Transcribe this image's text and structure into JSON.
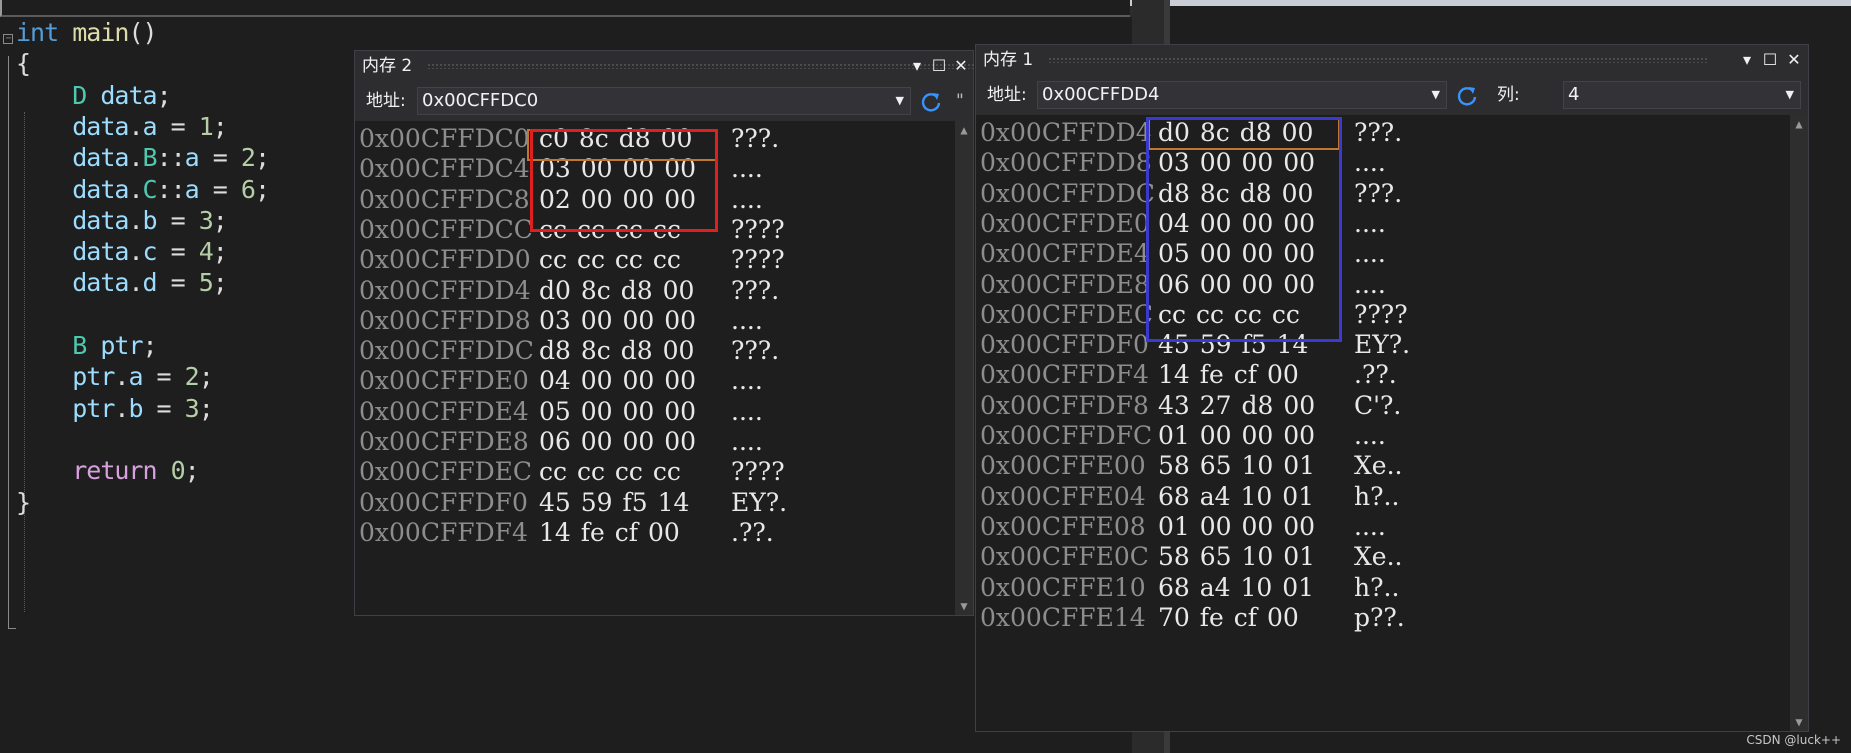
{
  "code": {
    "lines": [
      {
        "parts": [
          {
            "t": "int",
            "c": "k-blue"
          },
          {
            "t": " ",
            "c": "k-white"
          },
          {
            "t": "main",
            "c": "k-yellow"
          },
          {
            "t": "()",
            "c": "k-white"
          }
        ]
      },
      {
        "parts": [
          {
            "t": "{",
            "c": "k-white"
          }
        ]
      },
      {
        "parts": [
          {
            "t": "    ",
            "c": "k-white"
          },
          {
            "t": "D",
            "c": "k-green"
          },
          {
            "t": " ",
            "c": "k-white"
          },
          {
            "t": "data",
            "c": "k-var"
          },
          {
            "t": ";",
            "c": "k-white"
          }
        ]
      },
      {
        "parts": [
          {
            "t": "    ",
            "c": "k-white"
          },
          {
            "t": "data",
            "c": "k-var"
          },
          {
            "t": ".",
            "c": "k-white"
          },
          {
            "t": "a",
            "c": "k-var"
          },
          {
            "t": " = ",
            "c": "k-white"
          },
          {
            "t": "1",
            "c": "k-num"
          },
          {
            "t": ";",
            "c": "k-white"
          }
        ]
      },
      {
        "parts": [
          {
            "t": "    ",
            "c": "k-white"
          },
          {
            "t": "data",
            "c": "k-var"
          },
          {
            "t": ".",
            "c": "k-white"
          },
          {
            "t": "B",
            "c": "k-green"
          },
          {
            "t": "::",
            "c": "k-white"
          },
          {
            "t": "a",
            "c": "k-var"
          },
          {
            "t": " = ",
            "c": "k-white"
          },
          {
            "t": "2",
            "c": "k-num"
          },
          {
            "t": ";",
            "c": "k-white"
          }
        ]
      },
      {
        "parts": [
          {
            "t": "    ",
            "c": "k-white"
          },
          {
            "t": "data",
            "c": "k-var"
          },
          {
            "t": ".",
            "c": "k-white"
          },
          {
            "t": "C",
            "c": "k-green"
          },
          {
            "t": "::",
            "c": "k-white"
          },
          {
            "t": "a",
            "c": "k-var"
          },
          {
            "t": " = ",
            "c": "k-white"
          },
          {
            "t": "6",
            "c": "k-num"
          },
          {
            "t": ";",
            "c": "k-white"
          }
        ]
      },
      {
        "parts": [
          {
            "t": "    ",
            "c": "k-white"
          },
          {
            "t": "data",
            "c": "k-var"
          },
          {
            "t": ".",
            "c": "k-white"
          },
          {
            "t": "b",
            "c": "k-var"
          },
          {
            "t": " = ",
            "c": "k-white"
          },
          {
            "t": "3",
            "c": "k-num"
          },
          {
            "t": ";",
            "c": "k-white"
          }
        ]
      },
      {
        "parts": [
          {
            "t": "    ",
            "c": "k-white"
          },
          {
            "t": "data",
            "c": "k-var"
          },
          {
            "t": ".",
            "c": "k-white"
          },
          {
            "t": "c",
            "c": "k-var"
          },
          {
            "t": " = ",
            "c": "k-white"
          },
          {
            "t": "4",
            "c": "k-num"
          },
          {
            "t": ";",
            "c": "k-white"
          }
        ]
      },
      {
        "parts": [
          {
            "t": "    ",
            "c": "k-white"
          },
          {
            "t": "data",
            "c": "k-var"
          },
          {
            "t": ".",
            "c": "k-white"
          },
          {
            "t": "d",
            "c": "k-var"
          },
          {
            "t": " = ",
            "c": "k-white"
          },
          {
            "t": "5",
            "c": "k-num"
          },
          {
            "t": ";",
            "c": "k-white"
          }
        ]
      },
      {
        "parts": []
      },
      {
        "parts": [
          {
            "t": "    ",
            "c": "k-white"
          },
          {
            "t": "B",
            "c": "k-green"
          },
          {
            "t": " ",
            "c": "k-white"
          },
          {
            "t": "ptr",
            "c": "k-var"
          },
          {
            "t": ";",
            "c": "k-white"
          }
        ]
      },
      {
        "parts": [
          {
            "t": "    ",
            "c": "k-white"
          },
          {
            "t": "ptr",
            "c": "k-var"
          },
          {
            "t": ".",
            "c": "k-white"
          },
          {
            "t": "a",
            "c": "k-var"
          },
          {
            "t": " = ",
            "c": "k-white"
          },
          {
            "t": "2",
            "c": "k-num"
          },
          {
            "t": ";",
            "c": "k-white"
          }
        ]
      },
      {
        "parts": [
          {
            "t": "    ",
            "c": "k-white"
          },
          {
            "t": "ptr",
            "c": "k-var"
          },
          {
            "t": ".",
            "c": "k-white"
          },
          {
            "t": "b",
            "c": "k-var"
          },
          {
            "t": " = ",
            "c": "k-white"
          },
          {
            "t": "3",
            "c": "k-num"
          },
          {
            "t": ";",
            "c": "k-white"
          }
        ]
      },
      {
        "parts": []
      },
      {
        "parts": [
          {
            "t": "    ",
            "c": "k-white"
          },
          {
            "t": "return",
            "c": "k-purple"
          },
          {
            "t": " ",
            "c": "k-white"
          },
          {
            "t": "0",
            "c": "k-num"
          },
          {
            "t": ";",
            "c": "k-white"
          }
        ]
      },
      {
        "parts": [
          {
            "t": "}",
            "c": "k-white"
          }
        ]
      }
    ],
    "fold_marker": "−"
  },
  "mem2": {
    "title": "内存 2",
    "address_label": "地址:",
    "address_value": "0x00CFFDC0",
    "dropdown_arrow": "▼",
    "rows": [
      {
        "addr": "0x00CFFDC0",
        "bytes": "c0 8c d8 00",
        "ascii": "???."
      },
      {
        "addr": "0x00CFFDC4",
        "bytes": "03 00 00 00",
        "ascii": "...."
      },
      {
        "addr": "0x00CFFDC8",
        "bytes": "02 00 00 00",
        "ascii": "...."
      },
      {
        "addr": "0x00CFFDCC",
        "bytes": "cc cc cc cc",
        "ascii": "????"
      },
      {
        "addr": "0x00CFFDD0",
        "bytes": "cc cc cc cc",
        "ascii": "????"
      },
      {
        "addr": "0x00CFFDD4",
        "bytes": "d0 8c d8 00",
        "ascii": "???."
      },
      {
        "addr": "0x00CFFDD8",
        "bytes": "03 00 00 00",
        "ascii": "...."
      },
      {
        "addr": "0x00CFFDDC",
        "bytes": "d8 8c d8 00",
        "ascii": "???."
      },
      {
        "addr": "0x00CFFDE0",
        "bytes": "04 00 00 00",
        "ascii": "...."
      },
      {
        "addr": "0x00CFFDE4",
        "bytes": "05 00 00 00",
        "ascii": "...."
      },
      {
        "addr": "0x00CFFDE8",
        "bytes": "06 00 00 00",
        "ascii": "...."
      },
      {
        "addr": "0x00CFFDEC",
        "bytes": "cc cc cc cc",
        "ascii": "????"
      },
      {
        "addr": "0x00CFFDF0",
        "bytes": "45 59 f5 14",
        "ascii": "EY?."
      },
      {
        "addr": "0x00CFFDF4",
        "bytes": "14 fe cf 00",
        "ascii": ".??."
      }
    ]
  },
  "mem1": {
    "title": "内存 1",
    "address_label": "地址:",
    "address_value": "0x00CFFDD4",
    "columns_label": "列:",
    "columns_value": "4",
    "dropdown_arrow": "▼",
    "rows": [
      {
        "addr": "0x00CFFDD4",
        "bytes": "d0 8c d8 00",
        "ascii": "???."
      },
      {
        "addr": "0x00CFFDD8",
        "bytes": "03 00 00 00",
        "ascii": "...."
      },
      {
        "addr": "0x00CFFDDC",
        "bytes": "d8 8c d8 00",
        "ascii": "???."
      },
      {
        "addr": "0x00CFFDE0",
        "bytes": "04 00 00 00",
        "ascii": "...."
      },
      {
        "addr": "0x00CFFDE4",
        "bytes": "05 00 00 00",
        "ascii": "...."
      },
      {
        "addr": "0x00CFFDE8",
        "bytes": "06 00 00 00",
        "ascii": "...."
      },
      {
        "addr": "0x00CFFDEC",
        "bytes": "cc cc cc cc",
        "ascii": "????"
      },
      {
        "addr": "0x00CFFDF0",
        "bytes": "45 59 f5 14",
        "ascii": "EY?."
      },
      {
        "addr": "0x00CFFDF4",
        "bytes": "14 fe cf 00",
        "ascii": ".??."
      },
      {
        "addr": "0x00CFFDF8",
        "bytes": "43 27 d8 00",
        "ascii": "C'?."
      },
      {
        "addr": "0x00CFFDFC",
        "bytes": "01 00 00 00",
        "ascii": "...."
      },
      {
        "addr": "0x00CFFE00",
        "bytes": "58 65 10 01",
        "ascii": "Xe.."
      },
      {
        "addr": "0x00CFFE04",
        "bytes": "68 a4 10 01",
        "ascii": "h?.."
      },
      {
        "addr": "0x00CFFE08",
        "bytes": "01 00 00 00",
        "ascii": "...."
      },
      {
        "addr": "0x00CFFE0C",
        "bytes": "58 65 10 01",
        "ascii": "Xe.."
      },
      {
        "addr": "0x00CFFE10",
        "bytes": "68 a4 10 01",
        "ascii": "h?.."
      },
      {
        "addr": "0x00CFFE14",
        "bytes": "70 fe cf 00",
        "ascii": "p??."
      }
    ]
  },
  "window_buttons": {
    "dropdown": "▾",
    "maximize": "☐",
    "close": "✕"
  },
  "scroll": {
    "up": "▲",
    "down": "▼"
  },
  "watermark": "CSDN @luck++",
  "colors": {
    "background": "#1e1e1e",
    "highlight_red": "#e02020",
    "highlight_blue": "#3a3ad0",
    "highlight_orange": "#c07830"
  }
}
